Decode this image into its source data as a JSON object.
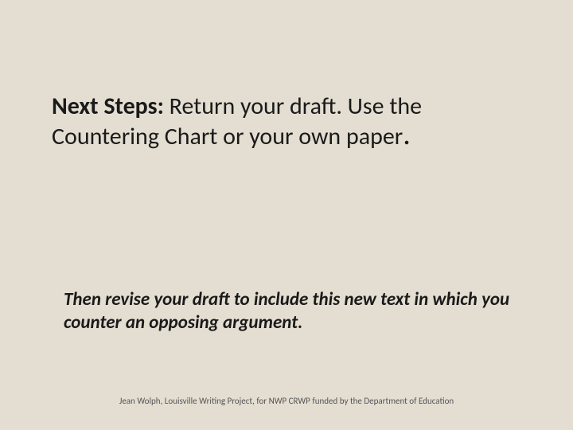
{
  "title": {
    "bold_lead": "Next Steps:",
    "rest": "  Return your draft. Use the Countering Chart or your own paper",
    "period": "."
  },
  "body": "Then revise your draft to include this new text in which you counter an opposing argument.",
  "footer": "Jean Wolph, Louisville Writing Project, for NWP CRWP funded by the Department of Education"
}
